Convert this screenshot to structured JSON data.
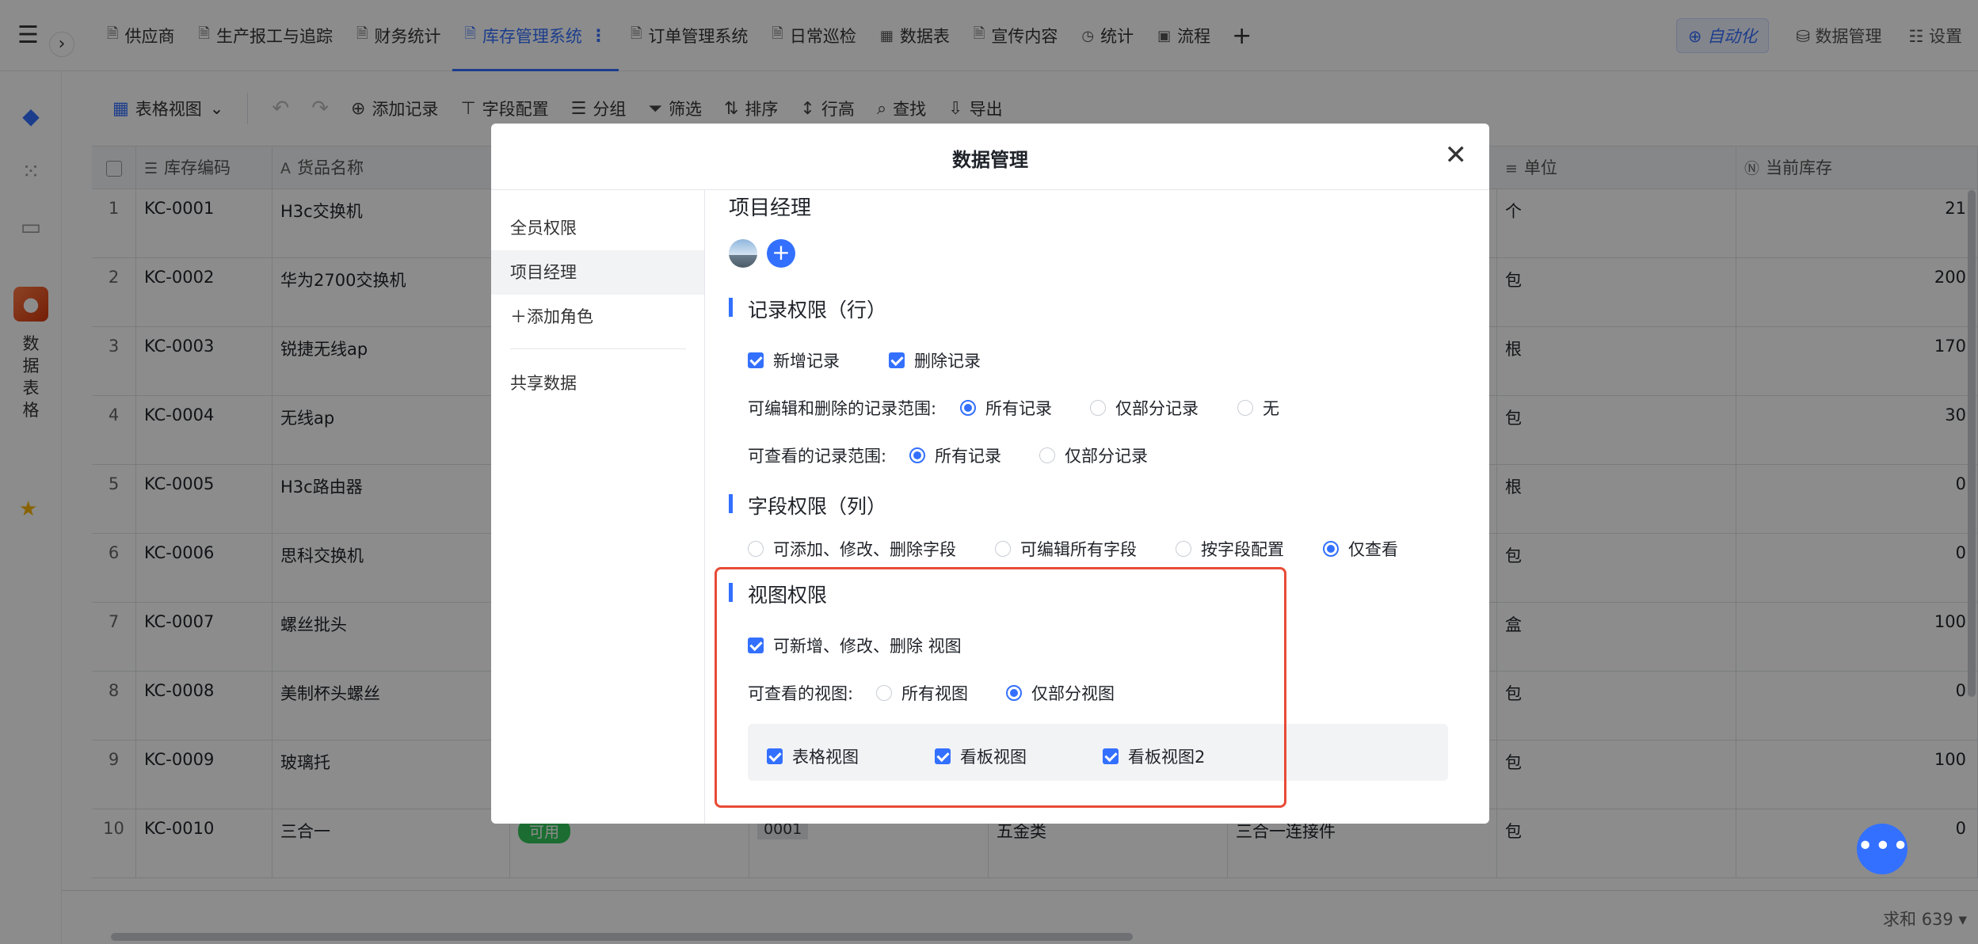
{
  "topnav": {
    "tabs": [
      {
        "label": "供应商",
        "active": false
      },
      {
        "label": "生产报工与追踪",
        "active": false
      },
      {
        "label": "财务统计",
        "active": false
      },
      {
        "label": "库存管理系统",
        "active": true
      },
      {
        "label": "订单管理系统",
        "active": false
      },
      {
        "label": "日常巡检",
        "active": false
      },
      {
        "label": "数据表",
        "active": false
      },
      {
        "label": "宣传内容",
        "active": false
      },
      {
        "label": "统计",
        "active": false
      },
      {
        "label": "流程",
        "active": false
      }
    ],
    "automation": "自动化",
    "data_management": "数据管理",
    "settings": "设置",
    "accent_color": "#3370ff"
  },
  "leftrail": {
    "app_name": "数据表格"
  },
  "toolbar": {
    "view_selector": "表格视图",
    "add_record": "添加记录",
    "field_config": "字段配置",
    "group": "分组",
    "filter": "筛选",
    "sort": "排序",
    "row_height": "行高",
    "find": "查找",
    "export": "导出"
  },
  "table": {
    "headers": {
      "code": "库存编码",
      "name": "货品名称",
      "unit": "单位",
      "stock": "当前库存"
    },
    "rows": [
      {
        "idx": "1",
        "code": "KC-0001",
        "name": "H3c交换机",
        "unit": "个",
        "stock": "21"
      },
      {
        "idx": "2",
        "code": "KC-0002",
        "name": "华为2700交换机",
        "unit": "包",
        "stock": "200"
      },
      {
        "idx": "3",
        "code": "KC-0003",
        "name": "锐捷无线ap",
        "unit": "根",
        "stock": "170"
      },
      {
        "idx": "4",
        "code": "KC-0004",
        "name": "无线ap",
        "unit": "包",
        "stock": "30"
      },
      {
        "idx": "5",
        "code": "KC-0005",
        "name": "H3c路由器",
        "unit": "根",
        "stock": "0"
      },
      {
        "idx": "6",
        "code": "KC-0006",
        "name": "思科交换机",
        "unit": "包",
        "stock": "0"
      },
      {
        "idx": "7",
        "code": "KC-0007",
        "name": "螺丝批头",
        "unit": "盒",
        "stock": "100"
      },
      {
        "idx": "8",
        "code": "KC-0008",
        "name": "美制杯头螺丝",
        "unit": "包",
        "stock": "0"
      },
      {
        "idx": "9",
        "code": "KC-0009",
        "name": "玻璃托",
        "unit": "包",
        "stock": "100"
      },
      {
        "idx": "10",
        "code": "KC-0010",
        "name": "三合一",
        "unit": "包",
        "stock": "0",
        "status": "可用",
        "serial": "0001",
        "category": "五金类",
        "spec": "三合一连接件"
      }
    ],
    "sum_label": "求和 639"
  },
  "modal": {
    "title": "数据管理",
    "sidebar": {
      "all_members": "全员权限",
      "project_manager": "项目经理",
      "add_role": "添加角色",
      "shared_data": "共享数据"
    },
    "role_title": "项目经理",
    "record_perm": {
      "title": "记录权限（行）",
      "add_record": "新增记录",
      "delete_record": "删除记录",
      "edit_scope_label": "可编辑和删除的记录范围:",
      "edit_all": "所有记录",
      "edit_partial": "仅部分记录",
      "edit_none": "无",
      "view_scope_label": "可查看的记录范围:",
      "view_all": "所有记录",
      "view_partial": "仅部分记录"
    },
    "field_perm": {
      "title": "字段权限（列）",
      "opt1": "可添加、修改、删除字段",
      "opt2": "可编辑所有字段",
      "opt3": "按字段配置",
      "opt4": "仅查看"
    },
    "view_perm": {
      "title": "视图权限",
      "manage_views": "可新增、修改、删除 视图",
      "viewable_label": "可查看的视图:",
      "all_views": "所有视图",
      "partial_views": "仅部分视图",
      "views": [
        "表格视图",
        "看板视图",
        "看板视图2"
      ]
    },
    "highlight_color": "#e84b36"
  }
}
